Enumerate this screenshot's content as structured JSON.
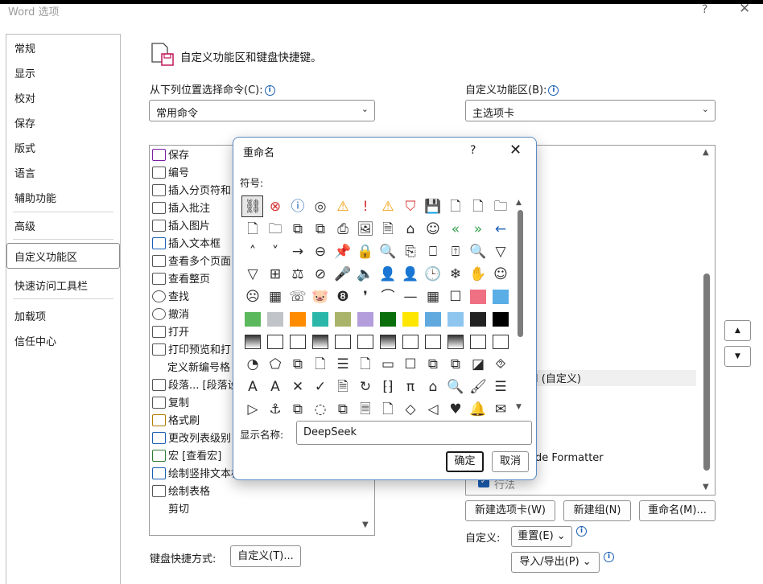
{
  "window": {
    "title": "Word 选项",
    "help": "?",
    "close": "✕"
  },
  "nav": {
    "items": [
      "常规",
      "显示",
      "校对",
      "保存",
      "版式",
      "语言",
      "辅助功能",
      "高级",
      "自定义功能区",
      "快速访问工具栏",
      "加载项",
      "信任中心"
    ],
    "selected": "自定义功能区"
  },
  "header": {
    "title": "自定义功能区和键盘快捷键。"
  },
  "left": {
    "label": "从下列位置选择命令(C):",
    "combo": "常用命令",
    "list": [
      "保存",
      "编号",
      "插入分页符和",
      "插入批注",
      "插入图片",
      "插入文本框",
      "查看多个页面",
      "查看整页",
      "查找",
      "撤消",
      "打开",
      "打印预览和打",
      "定义新编号格",
      "段落... [段落设",
      "复制",
      "格式刷",
      "更改列表级别",
      "宏 [查看宏]",
      "绘制竖排文本框",
      "绘制表格",
      "剪切"
    ]
  },
  "right": {
    "label": "自定义功能区(B):",
    "combo": "主选项卡",
    "visible_items": {
      "custom_group": "l (自定义)",
      "formatter": "de Formatter",
      "checked_item": "行法"
    }
  },
  "buttons": {
    "new_tab": "新建选项卡(W)",
    "new_group": "新建组(N)",
    "rename": "重命名(M)...",
    "customize_label": "自定义:",
    "reset": "重置(E) ⌄",
    "import_export": "导入/导出(P) ⌄",
    "keyboard_label": "键盘快捷方式:",
    "keyboard_btn": "自定义(T)..."
  },
  "dialog": {
    "title": "重命名",
    "help": "?",
    "close": "✕",
    "symbol_label": "符号:",
    "name_label": "显示名称:",
    "name_value": "DeepSeek",
    "ok": "确定",
    "cancel": "取消",
    "symbols": {
      "row1": [
        "⛓",
        "⊗",
        "ⓘ",
        "◎",
        "⚠",
        "!",
        "⚠",
        "⛉",
        "💾",
        "🗋",
        "🗋",
        "🗀"
      ],
      "row2": [
        "🗋",
        "🗀",
        "⧉",
        "⧉",
        "⎙",
        "🖼",
        "🗎",
        "⌂",
        "☺",
        "«",
        "»",
        "←"
      ],
      "row3": [
        "˄",
        "˅",
        "→",
        "⊖",
        "📌",
        "🔒",
        "🔍",
        "⎘",
        "⎕",
        "⍐",
        "🔍",
        "▽"
      ],
      "row4": [
        "▽",
        "⊞",
        "⚖",
        "⊘",
        "🎤",
        "🔈",
        "👤",
        "👤",
        "🕒",
        "❄",
        "✋",
        "☺"
      ],
      "row5": [
        "☹",
        "▦",
        "☏",
        "🐷",
        "❽",
        "❜",
        "⌒",
        "—",
        "▦",
        "☐",
        "■",
        "■"
      ],
      "row8": [
        "◔",
        "⬠",
        "⧉",
        "🗋",
        "☰",
        "🗋",
        "▭",
        "☐",
        "⧉",
        "⧉",
        "◪",
        "⯑"
      ],
      "row9": [
        "A",
        "A",
        "✕",
        "✓",
        "🗎",
        "↻",
        "⁅⁆",
        "π",
        "⌂",
        "🔍",
        "🖌",
        "☰"
      ],
      "row10": [
        "▷",
        "⚓",
        "⧉",
        "◌",
        "⧉",
        "🗏",
        "🗋",
        "◇",
        "◁",
        "♥",
        "🔔",
        "✉"
      ]
    },
    "swatches": {
      "row6": [
        "#5cb85c",
        "#c0c4c8",
        "#ff8c00",
        "#2ab7a9",
        "#a9b46a",
        "#b39ddb",
        "#0a6e0a",
        "#ffe600",
        "#5fa9df",
        "#8ec6ef",
        "#222222",
        "#000000"
      ],
      "row5_right": [
        "#f07083",
        "#5aaee6"
      ]
    }
  }
}
